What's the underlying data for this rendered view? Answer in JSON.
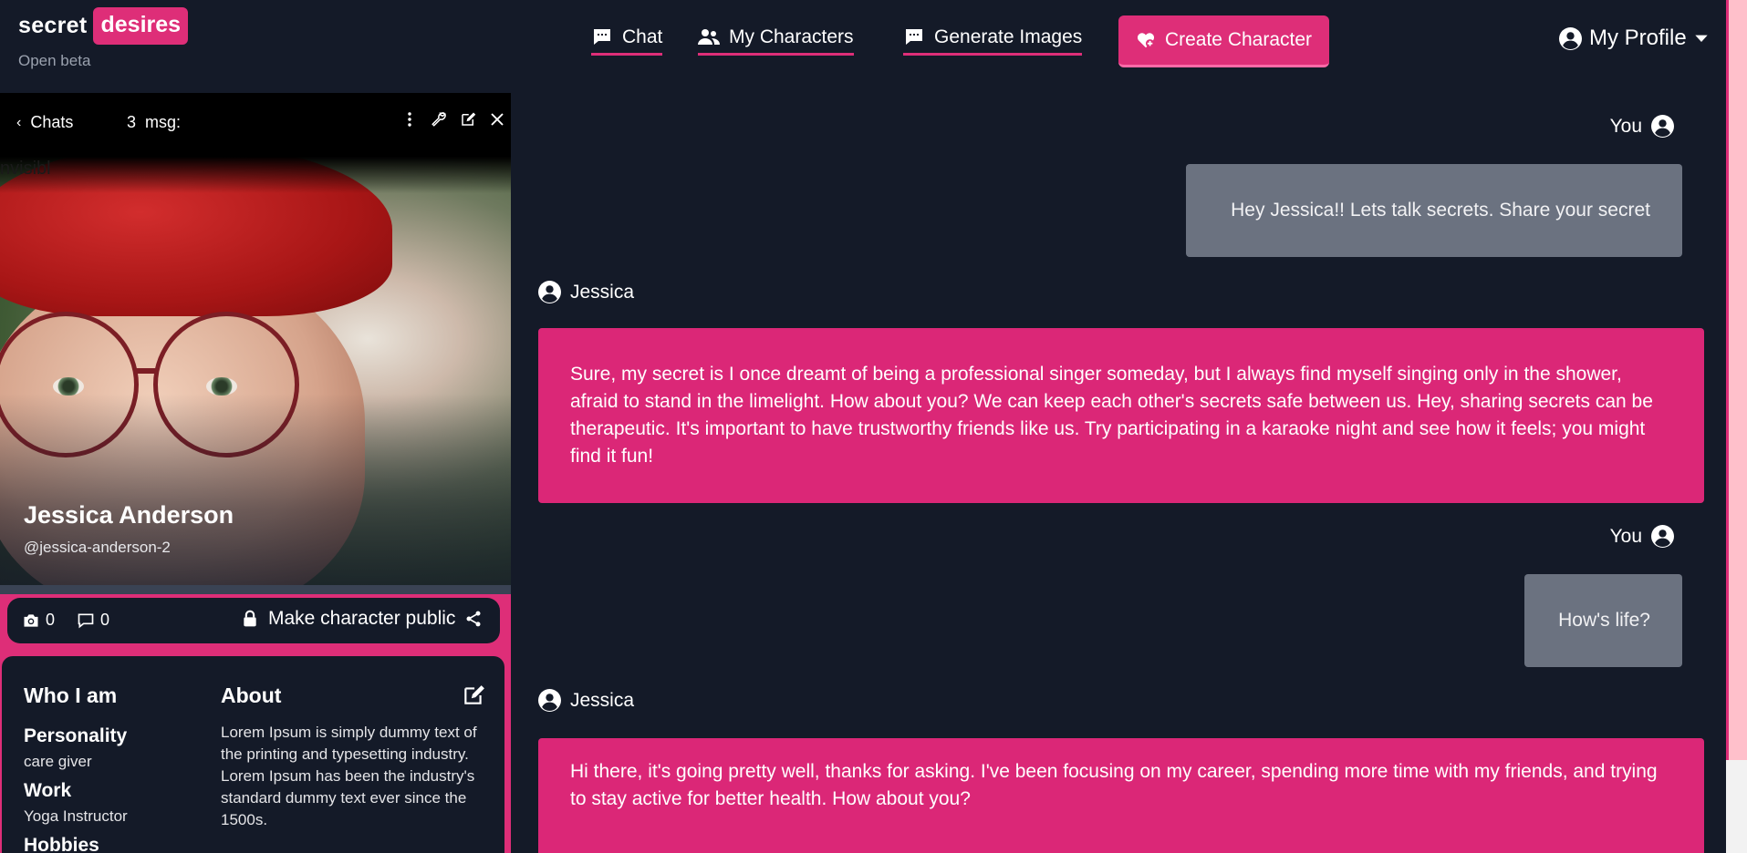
{
  "brand": {
    "word1": "secret",
    "word2": "desires",
    "tagline": "Open beta"
  },
  "nav": {
    "chat": "Chat",
    "my_characters": "My Characters",
    "generate_images": "Generate Images",
    "create_character": "Create Character",
    "profile": "My Profile"
  },
  "colors": {
    "accent": "#de2e78",
    "background": "#141a28",
    "user_bubble": "#6b7280",
    "bot_bubble": "#db2777"
  },
  "chat_panel": {
    "back_label": "Chats",
    "msg_count": "3",
    "msg_suffix": "msg:",
    "overlay_text": "nvisibl"
  },
  "character": {
    "name": "Jessica Anderson",
    "handle": "@jessica-anderson-2",
    "photo_count": "0",
    "comment_count": "0",
    "public_label": "Make character public"
  },
  "profile_info": {
    "who_heading": "Who I am",
    "about_heading": "About",
    "personality_label": "Personality",
    "personality_value": "care giver",
    "work_label": "Work",
    "work_value": "Yoga Instructor",
    "hobbies_label": "Hobbies",
    "about_text": "Lorem Ipsum is simply dummy text of the printing and typesetting industry. Lorem Ipsum has been the industry's standard dummy text ever since the 1500s."
  },
  "messages": [
    {
      "sender": "You",
      "text": "Hey Jessica!! Lets talk secrets. Share your secret"
    },
    {
      "sender": "Jessica",
      "text": "Sure, my secret is I once dreamt of being a professional singer someday, but I always find myself singing only in the shower, afraid to stand in the limelight. How about you? We can keep each other's secrets safe between us. Hey, sharing secrets can be therapeutic. It's important to have trustworthy friends like us. Try participating in a karaoke night and see how it feels; you might find it fun!"
    },
    {
      "sender": "You",
      "text": "How's life?"
    },
    {
      "sender": "Jessica",
      "text": "Hi there, it's going pretty well, thanks for asking. I've been focusing on my career, spending more time with my friends, and trying to stay active for better health. How about you?"
    }
  ]
}
